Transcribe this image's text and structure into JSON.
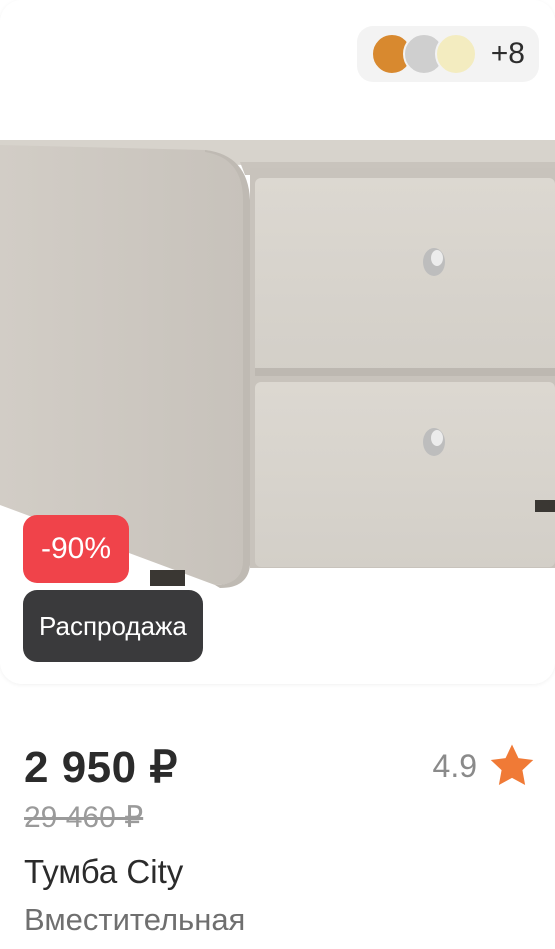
{
  "colors": {
    "swatch_orange": "#d8892f",
    "swatch_gray": "#cfcfcf",
    "swatch_cream": "#f3ecc0",
    "discount_red": "#f0434a",
    "sale_dark": "#3a3a3c",
    "star_orange": "#f07a36"
  },
  "product": {
    "image_icon": "nightstand-image",
    "swatches_more": "+8",
    "discount": "-90%",
    "sale_label": "Распродажа",
    "price": "2 950 ₽",
    "old_price": "29 460 ₽",
    "rating": "4.9",
    "title": "Тумба City",
    "subtitle": "Вместительная"
  }
}
